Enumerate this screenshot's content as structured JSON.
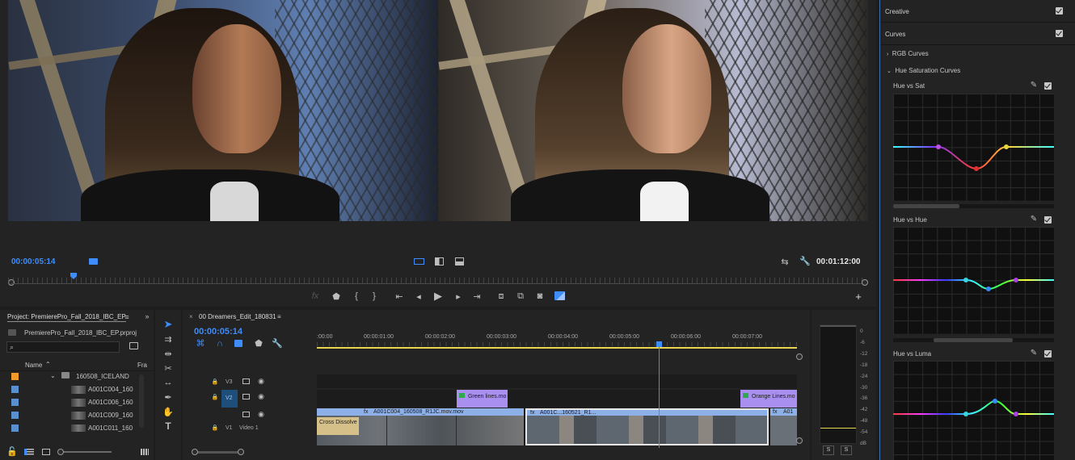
{
  "monitor": {
    "timecode_current": "00:00:05:14",
    "timecode_duration": "00:01:12:00",
    "playback_icons": [
      "marker-icon",
      "in-point-icon",
      "out-point-icon",
      "go-to-in-icon",
      "step-back-icon",
      "play-icon",
      "step-forward-icon",
      "go-to-out-icon",
      "lift-icon",
      "extract-icon",
      "camera-icon",
      "compare-icon"
    ],
    "playhead_fraction": 0.073
  },
  "lumetri": {
    "sections": [
      {
        "label": "Creative",
        "checked": true
      },
      {
        "label": "Curves",
        "checked": true
      }
    ],
    "subsections": [
      {
        "label": "RGB Curves",
        "expanded": false
      },
      {
        "label": "Hue Saturation Curves",
        "expanded": true
      }
    ],
    "curves": [
      {
        "label": "Hue vs Sat"
      },
      {
        "label": "Hue vs Hue"
      },
      {
        "label": "Hue vs Luma"
      }
    ]
  },
  "project": {
    "tab_label": "Project: PremierePro_Fall_2018_IBC_EP",
    "file_label": "PremierePro_Fall_2018_IBC_EP.prproj",
    "col_name": "Name",
    "col_fr": "Fra",
    "items": [
      {
        "name": "160508_ICELAND",
        "color": "#f29b2b",
        "type": "folder"
      },
      {
        "name": "A001C004_160",
        "color": "#5a8fd0",
        "type": "clip"
      },
      {
        "name": "A001C006_160",
        "color": "#5a8fd0",
        "type": "clip"
      },
      {
        "name": "A001C009_160",
        "color": "#5a8fd0",
        "type": "clip"
      },
      {
        "name": "A001C011_160",
        "color": "#5a8fd0",
        "type": "clip"
      }
    ]
  },
  "timeline": {
    "tab_label": "00 Dreamers_Edit_180831",
    "timecode": "00:00:05:14",
    "ruler_labels": [
      ":00:00",
      "00:00:01:00",
      "00:00:02:00",
      "00:00:03:00",
      "00:00:04:00",
      "00:00:05:00",
      "00:00:06:00",
      "00:00:07:00"
    ],
    "tracks": [
      {
        "id": "V3",
        "name": ""
      },
      {
        "id": "V2",
        "name": ""
      },
      {
        "id": "",
        "name": ""
      },
      {
        "id": "V1",
        "name": "Video 1"
      }
    ],
    "clips": {
      "green_lines": "Green lines.mo",
      "orange_lines": "Orange Lines.mo",
      "main_clip": "A001C004_160508_R1JC.mov.mov",
      "second_clip": "A001C...160521_R1...",
      "last_clip": "A01",
      "transition": "Cross Dissolve"
    }
  },
  "meter": {
    "scale": [
      "0",
      "-6",
      "-12",
      "-18",
      "-24",
      "-30",
      "-36",
      "-42",
      "-48",
      "-54",
      "dB"
    ],
    "solo_labels": [
      "S",
      "S"
    ]
  },
  "colors": {
    "accent": "#3f8dfb",
    "clip_purple": "#a88ff0",
    "clip_blue": "#8db0e8",
    "track_yellow": "#e8d44d"
  }
}
